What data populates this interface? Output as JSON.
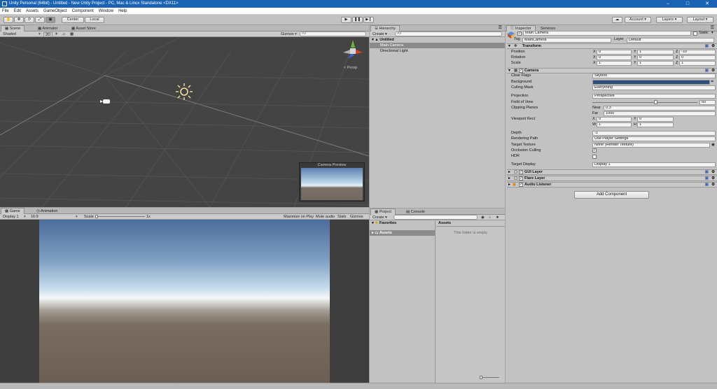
{
  "window": {
    "title": "Unity Personal (64bit) - Untitled - New Unity Project - PC, Mac & Linux Standalone <DX11>"
  },
  "menu": [
    "File",
    "Edit",
    "Assets",
    "GameObject",
    "Component",
    "Window",
    "Help"
  ],
  "toolbar": {
    "center": "Center",
    "local": "Local",
    "account": "Account",
    "layers": "Layers",
    "layout": "Layout"
  },
  "scene": {
    "tabs": [
      "Scene",
      "Animator",
      "Asset Store"
    ],
    "shading": "Shaded",
    "mode2d": "2D",
    "gizmos": "Gizmos",
    "search": "All",
    "persp": "< Persp",
    "camera_preview": "Camera Preview"
  },
  "game": {
    "tabs": [
      "Game",
      "Animation"
    ],
    "display": "Display 1",
    "aspect": "16:9",
    "scale_label": "Scale",
    "scale_value": "1x",
    "buttons": [
      "Maximize on Play",
      "Mute audio",
      "Stats",
      "Gizmos"
    ]
  },
  "hierarchy": {
    "tab": "Hierarchy",
    "create": "Create",
    "search": "All",
    "scene": "Untitled",
    "items": [
      "Main Camera",
      "Directional Light"
    ]
  },
  "project": {
    "tabs": [
      "Project",
      "Console"
    ],
    "create": "Create",
    "favorites": "Favorites",
    "assets": "Assets",
    "assets_header": "Assets",
    "empty": "This folder is empty"
  },
  "inspector": {
    "tabs": [
      "Inspector",
      "Services"
    ],
    "name": "Main Camera",
    "static": "Static",
    "tag_label": "Tag",
    "tag": "MainCamera",
    "layer_label": "Layer",
    "layer": "Default",
    "transform": {
      "title": "Transform",
      "position": {
        "label": "Position",
        "x": "0",
        "y": "1",
        "z": "-10"
      },
      "rotation": {
        "label": "Rotation",
        "x": "0",
        "y": "0",
        "z": "0"
      },
      "scale": {
        "label": "Scale",
        "x": "1",
        "y": "1",
        "z": "1"
      }
    },
    "camera": {
      "title": "Camera",
      "clear_flags_label": "Clear Flags",
      "clear_flags": "Skybox",
      "background_label": "Background",
      "culling_label": "Culling Mask",
      "culling": "Everything",
      "projection_label": "Projection",
      "projection": "Perspective",
      "fov_label": "Field of View",
      "fov": "60",
      "fov_slider": 0.6,
      "clip_label": "Clipping Planes",
      "near_label": "Near",
      "near": "0.3",
      "far_label": "Far",
      "far": "1000",
      "viewport_label": "Viewport Rect",
      "vx": "0",
      "vy": "0",
      "vw": "1",
      "vh": "1",
      "depth_label": "Depth",
      "depth": "-1",
      "rendering_label": "Rendering Path",
      "rendering": "Use Player Settings",
      "target_tex_label": "Target Texture",
      "target_tex": "None (Render Texture)",
      "occlusion_label": "Occlusion Culling",
      "hdr_label": "HDR",
      "target_display_label": "Target Display",
      "target_display": "Display 1"
    },
    "components": [
      "GUI Layer",
      "Flare Layer",
      "Audio Listener"
    ],
    "add_component": "Add Component"
  },
  "colors": {
    "accent": "#1a63b3",
    "camera_bg": "#314d79",
    "selection": "#8b8b8b"
  }
}
